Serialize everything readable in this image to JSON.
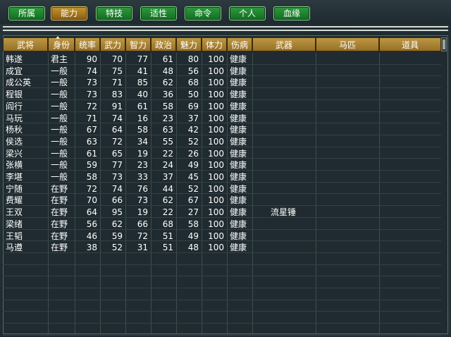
{
  "tabs": [
    {
      "label": "所属",
      "active": false
    },
    {
      "label": "能力",
      "active": true
    },
    {
      "label": "特技",
      "active": false
    },
    {
      "label": "适性",
      "active": false
    },
    {
      "label": "命令",
      "active": false
    },
    {
      "label": "个人",
      "active": false
    },
    {
      "label": "血缘",
      "active": false
    }
  ],
  "columns": [
    "武将",
    "身份",
    "统率",
    "武力",
    "智力",
    "政治",
    "魅力",
    "体力",
    "伤病",
    "武器",
    "马匹",
    "道具"
  ],
  "rows": [
    {
      "name": "韩遂",
      "status": "君主",
      "lead": "90",
      "war": "70",
      "int": "77",
      "pol": "61",
      "cha": "80",
      "hp": "100",
      "health": "健康",
      "weapon": "",
      "horse": "",
      "item": ""
    },
    {
      "name": "成宜",
      "status": "一般",
      "lead": "74",
      "war": "75",
      "int": "41",
      "pol": "48",
      "cha": "56",
      "hp": "100",
      "health": "健康",
      "weapon": "",
      "horse": "",
      "item": ""
    },
    {
      "name": "成公英",
      "status": "一般",
      "lead": "73",
      "war": "71",
      "int": "85",
      "pol": "62",
      "cha": "68",
      "hp": "100",
      "health": "健康",
      "weapon": "",
      "horse": "",
      "item": ""
    },
    {
      "name": "程银",
      "status": "一般",
      "lead": "73",
      "war": "83",
      "int": "40",
      "pol": "36",
      "cha": "50",
      "hp": "100",
      "health": "健康",
      "weapon": "",
      "horse": "",
      "item": ""
    },
    {
      "name": "阎行",
      "status": "一般",
      "lead": "72",
      "war": "91",
      "int": "61",
      "pol": "58",
      "cha": "69",
      "hp": "100",
      "health": "健康",
      "weapon": "",
      "horse": "",
      "item": ""
    },
    {
      "name": "马玩",
      "status": "一般",
      "lead": "71",
      "war": "74",
      "int": "16",
      "pol": "23",
      "cha": "37",
      "hp": "100",
      "health": "健康",
      "weapon": "",
      "horse": "",
      "item": ""
    },
    {
      "name": "杨秋",
      "status": "一般",
      "lead": "67",
      "war": "64",
      "int": "58",
      "pol": "63",
      "cha": "42",
      "hp": "100",
      "health": "健康",
      "weapon": "",
      "horse": "",
      "item": ""
    },
    {
      "name": "侯选",
      "status": "一般",
      "lead": "63",
      "war": "72",
      "int": "34",
      "pol": "55",
      "cha": "52",
      "hp": "100",
      "health": "健康",
      "weapon": "",
      "horse": "",
      "item": ""
    },
    {
      "name": "梁兴",
      "status": "一般",
      "lead": "61",
      "war": "65",
      "int": "19",
      "pol": "22",
      "cha": "26",
      "hp": "100",
      "health": "健康",
      "weapon": "",
      "horse": "",
      "item": ""
    },
    {
      "name": "张横",
      "status": "一般",
      "lead": "59",
      "war": "77",
      "int": "23",
      "pol": "24",
      "cha": "49",
      "hp": "100",
      "health": "健康",
      "weapon": "",
      "horse": "",
      "item": ""
    },
    {
      "name": "李堪",
      "status": "一般",
      "lead": "58",
      "war": "73",
      "int": "33",
      "pol": "37",
      "cha": "45",
      "hp": "100",
      "health": "健康",
      "weapon": "",
      "horse": "",
      "item": ""
    },
    {
      "name": "宁随",
      "status": "在野",
      "lead": "72",
      "war": "74",
      "int": "76",
      "pol": "44",
      "cha": "52",
      "hp": "100",
      "health": "健康",
      "weapon": "",
      "horse": "",
      "item": ""
    },
    {
      "name": "费耀",
      "status": "在野",
      "lead": "70",
      "war": "66",
      "int": "73",
      "pol": "62",
      "cha": "67",
      "hp": "100",
      "health": "健康",
      "weapon": "",
      "horse": "",
      "item": ""
    },
    {
      "name": "王双",
      "status": "在野",
      "lead": "64",
      "war": "95",
      "int": "19",
      "pol": "22",
      "cha": "27",
      "hp": "100",
      "health": "健康",
      "weapon": "流星锤",
      "horse": "",
      "item": ""
    },
    {
      "name": "梁绪",
      "status": "在野",
      "lead": "56",
      "war": "62",
      "int": "66",
      "pol": "68",
      "cha": "58",
      "hp": "100",
      "health": "健康",
      "weapon": "",
      "horse": "",
      "item": ""
    },
    {
      "name": "王韬",
      "status": "在野",
      "lead": "46",
      "war": "59",
      "int": "72",
      "pol": "51",
      "cha": "49",
      "hp": "100",
      "health": "健康",
      "weapon": "",
      "horse": "",
      "item": ""
    },
    {
      "name": "马遵",
      "status": "在野",
      "lead": "38",
      "war": "52",
      "int": "31",
      "pol": "51",
      "cha": "48",
      "hp": "100",
      "health": "健康",
      "weapon": "",
      "horse": "",
      "item": ""
    }
  ],
  "colors": {
    "tab_green": "#1f8a31",
    "tab_active": "#b08426",
    "header_gold": "#a88234",
    "panel_bg": "#1f2b30"
  },
  "sort_icon": "sort-up-arrow-icon"
}
